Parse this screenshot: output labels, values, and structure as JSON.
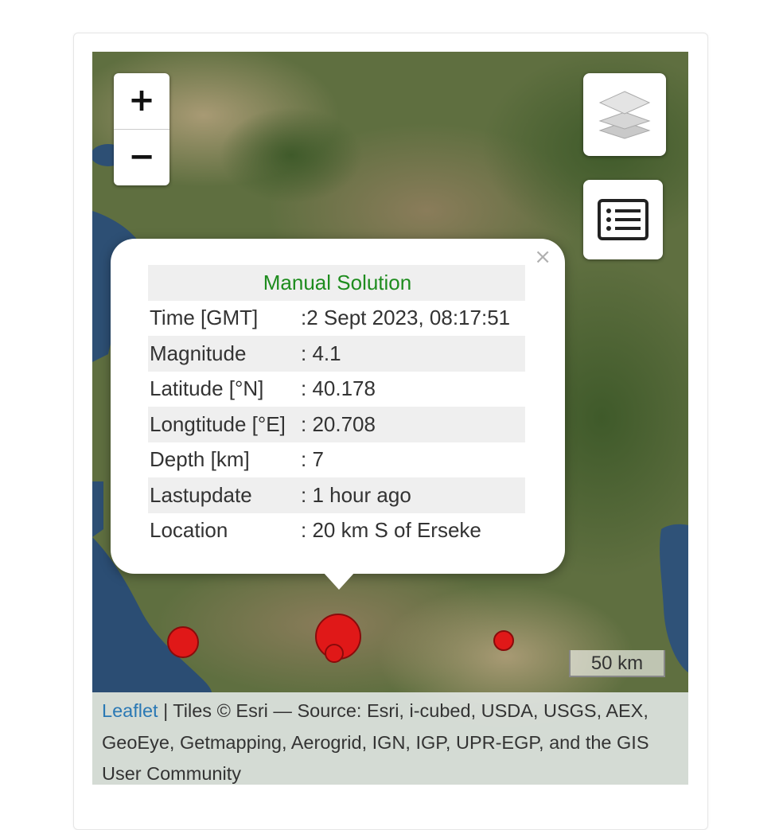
{
  "map": {
    "zoom_in_label": "+",
    "zoom_out_label": "−",
    "layers_icon": "layers-icon",
    "legend_icon": "list-icon",
    "marker_color": "#e01818"
  },
  "popup": {
    "title": "Manual Solution",
    "title_color": "#1e8c1e",
    "close_label": "×",
    "rows": [
      {
        "key": "Time [GMT]",
        "value": ":2 Sept 2023, 08:17:51"
      },
      {
        "key": "Magnitude",
        "value": ": 4.1"
      },
      {
        "key": "Latitude [°N]",
        "value": ": 40.178"
      },
      {
        "key": "Longtitude [°E]",
        "value": ": 20.708"
      },
      {
        "key": "Depth [km]",
        "value": ": 7"
      },
      {
        "key": "Lastupdate",
        "value": ": 1 hour ago"
      },
      {
        "key": "Location",
        "value": ": 20 km S of Erseke"
      }
    ]
  },
  "scale": {
    "label": "50 km"
  },
  "attribution": {
    "link_text": "Leaflet",
    "text": " | Tiles © Esri — Source: Esri, i-cubed, USDA, USGS, AEX, GeoEye, Getmapping, Aerogrid, IGN, IGP, UPR-EGP, and the GIS User Community"
  }
}
